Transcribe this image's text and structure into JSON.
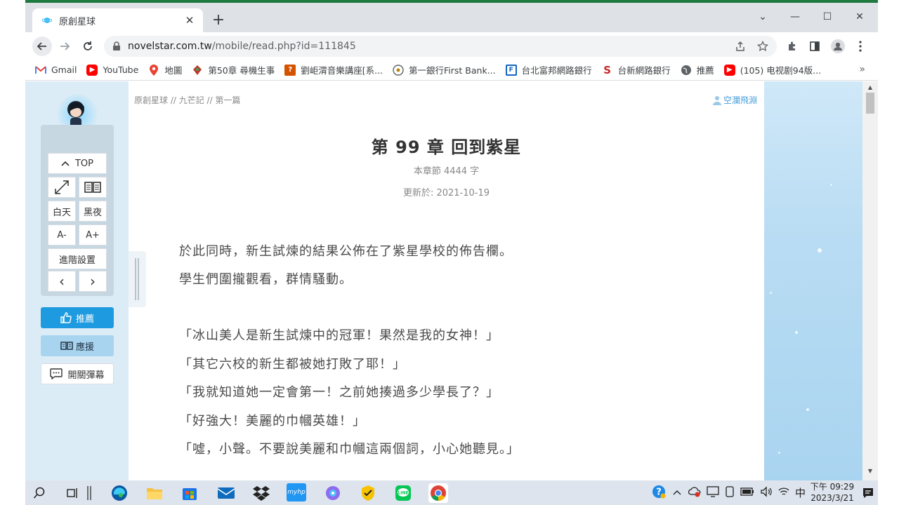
{
  "tab": {
    "title": "原創星球",
    "close": "✕",
    "new_tab": "+"
  },
  "window": {
    "chevron": "⌄",
    "minimize": "—",
    "maximize": "☐",
    "close": "✕"
  },
  "address": {
    "host": "novelstar.com.tw",
    "path": "/mobile/read.php?id=111845"
  },
  "bookmarks": [
    {
      "label": "Gmail",
      "icon": "gmail-icon",
      "color": "#ea4335"
    },
    {
      "label": "YouTube",
      "icon": "youtube-icon",
      "color": "#ff0000"
    },
    {
      "label": "地圖",
      "icon": "maps-icon",
      "color": "#34a853"
    },
    {
      "label": "第50章 尋機生事",
      "icon": "book-icon",
      "color": "#c0392b"
    },
    {
      "label": "劉岠渭音樂講座[系...",
      "icon": "music-icon",
      "color": "#d35400"
    },
    {
      "label": "第一銀行First Bank...",
      "icon": "bank-icon",
      "color": "#b8860b"
    },
    {
      "label": "台北富邦網路銀行",
      "icon": "fubon-icon",
      "color": "#1565c0"
    },
    {
      "label": "台新網路銀行",
      "icon": "taishin-icon",
      "color": "#c62828"
    },
    {
      "label": "推薦",
      "icon": "globe-icon",
      "color": "#5f6368"
    },
    {
      "label": "(105) 电视剧94版...",
      "icon": "youtube-icon",
      "color": "#ff0000"
    }
  ],
  "bookmarks_more": "»",
  "breadcrumb": "原創星球 // 九芒記 // 第一篇",
  "author": "空瀾飛淵",
  "chapter": {
    "title": "第 99 章 回到紫星",
    "word_count": "本章節 4444 字",
    "updated": "更新於: 2021-10-19"
  },
  "paragraphs": [
    "於此同時，新生試煉的結果公佈在了紫星學校的佈告欄。",
    "學生們圍攏觀看，群情騷動。",
    "「冰山美人是新生試煉中的冠軍！果然是我的女神！」",
    "「其它六校的新生都被她打敗了耶！」",
    "「我就知道她一定會第一！之前她揍過多少學長了？」",
    "「好強大！美麗的巾幗英雄！」",
    "「噓，小聲。不要說美麗和巾幗這兩個詞，小心她聽見。」"
  ],
  "panel": {
    "top": "TOP",
    "day": "白天",
    "night": "黑夜",
    "font_smaller": "A-",
    "font_larger": "A+",
    "advanced": "進階設置",
    "prev": "‹",
    "next": "›"
  },
  "actions": {
    "recommend": "推薦",
    "support": "應援",
    "danmaku": "開關彈幕"
  },
  "colors": {
    "recommend_bg": "#1e9be0",
    "support_bg": "#a8d4f0",
    "accent": "#4a9fd8"
  },
  "tray": {
    "ime": "中",
    "time": "下午 09:29",
    "date": "2023/3/21"
  }
}
